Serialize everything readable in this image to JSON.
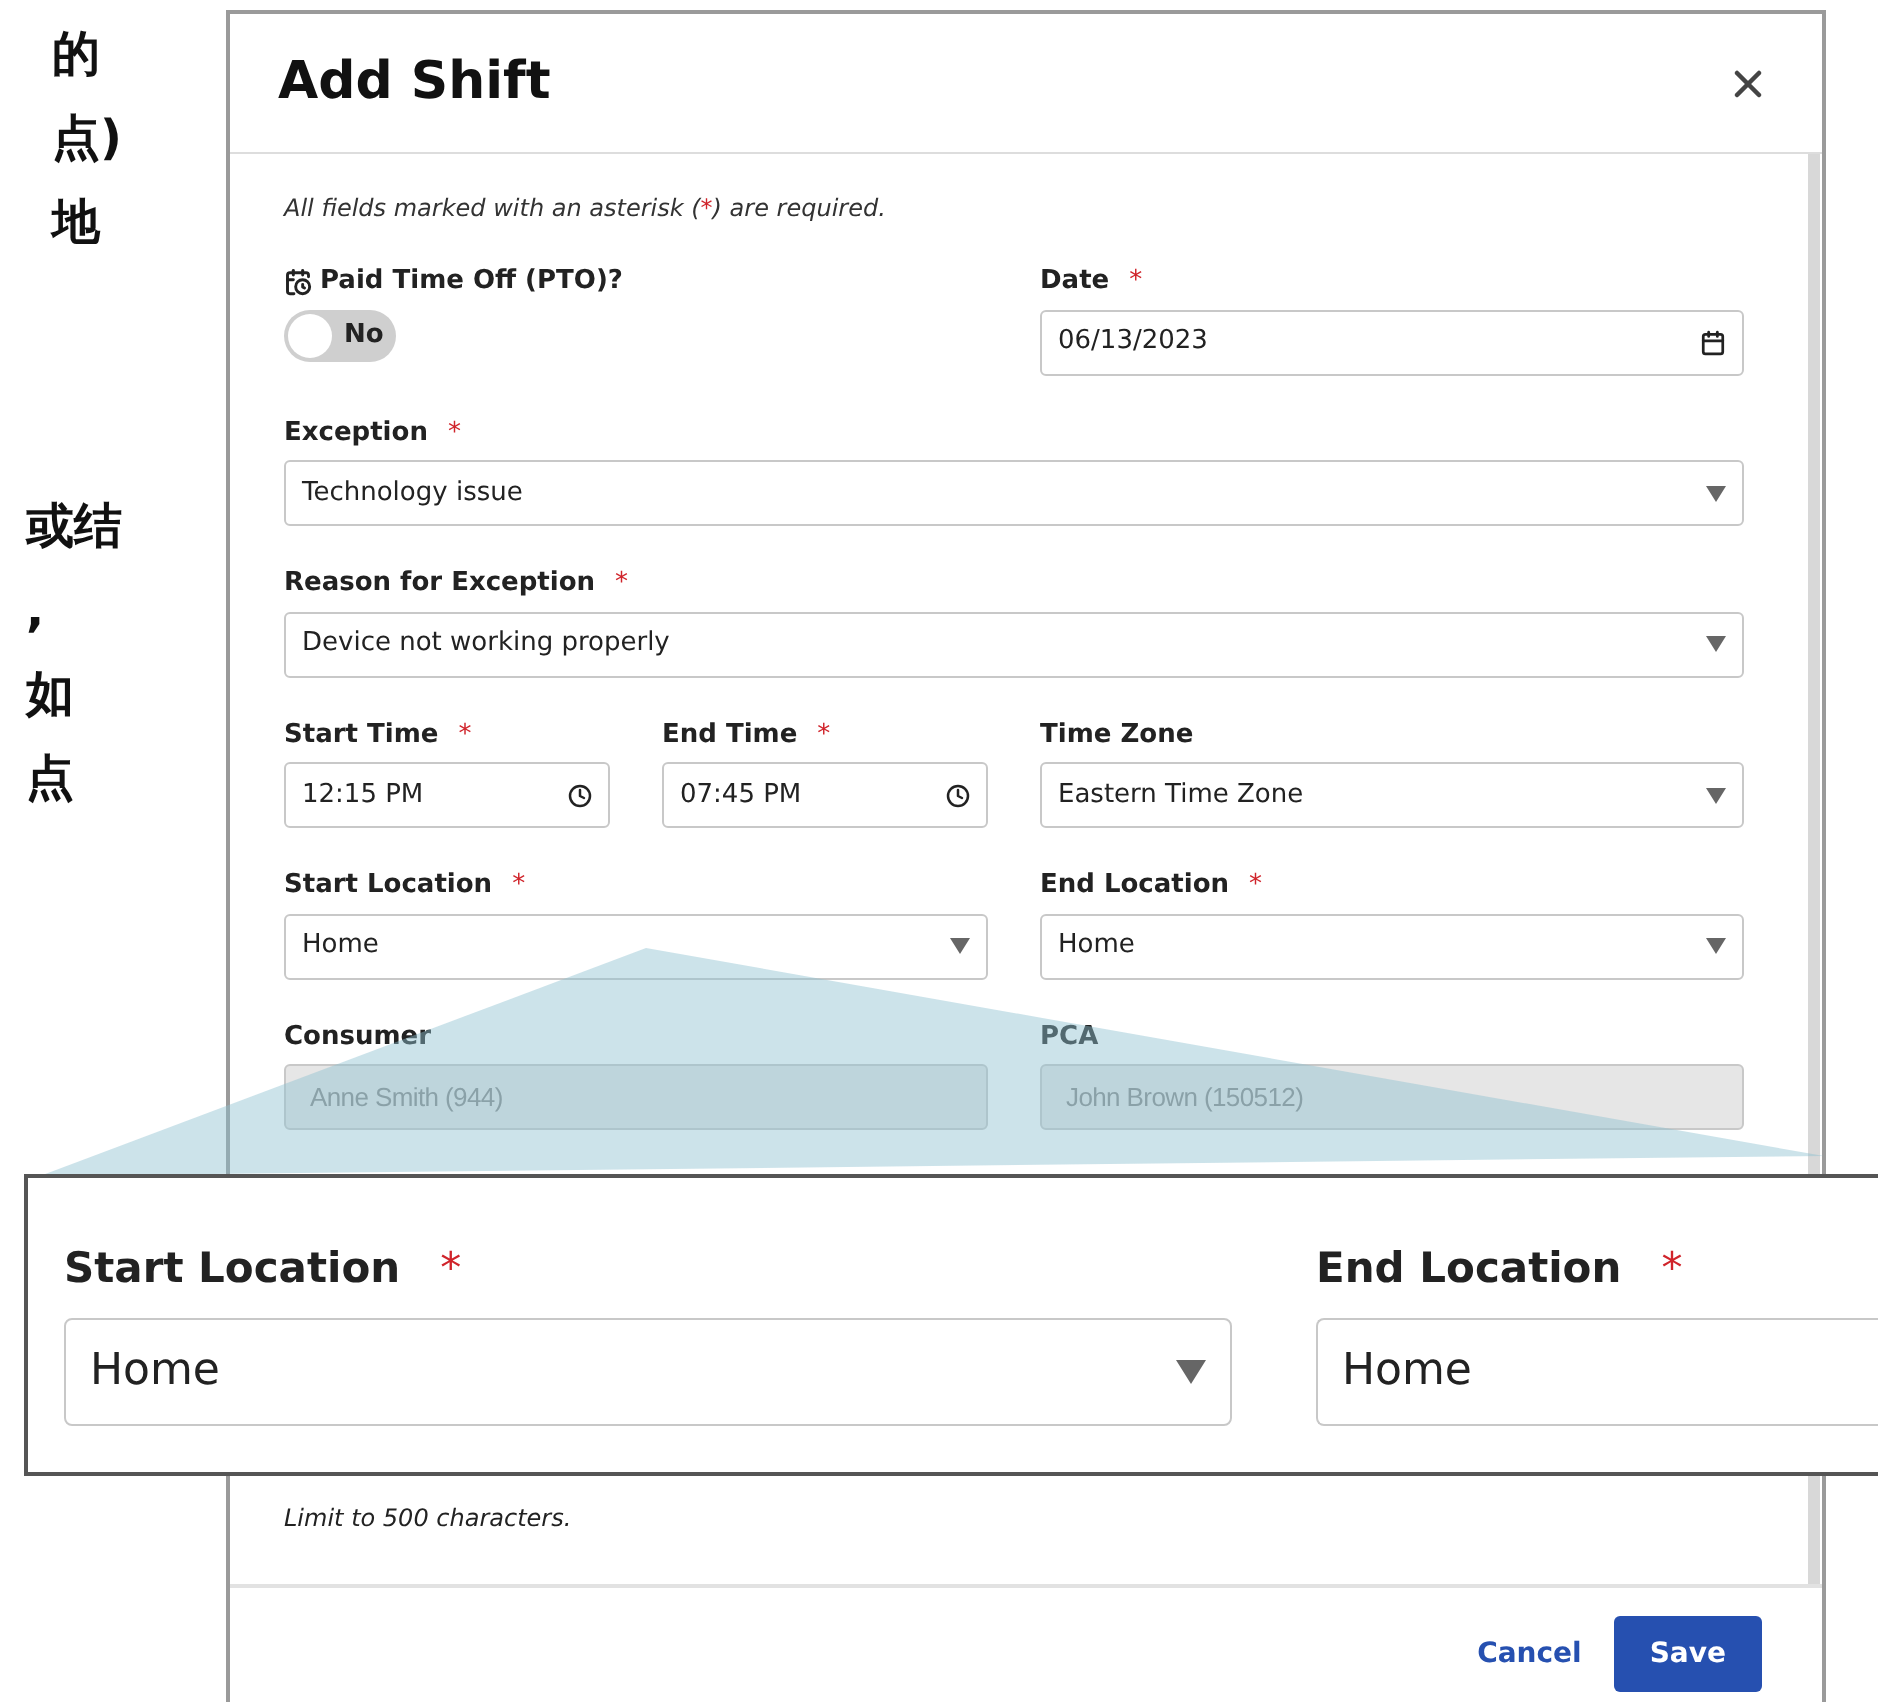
{
  "side_text": {
    "groups": [
      [
        "的",
        "点)",
        "地"
      ],
      [
        "或结",
        ",",
        "如",
        "点"
      ]
    ]
  },
  "dialog": {
    "title": "Add Shift",
    "required_note": {
      "before": "All fields marked with an asterisk (",
      "mark": "*",
      "after": ") are required."
    },
    "rows": [
      [
        {
          "kind": "toggle",
          "label": "Paid Time Off (PTO)?",
          "on": false,
          "value": "No"
        },
        {
          "kind": "date",
          "label": "Date",
          "mark": "*",
          "value": "06/13/2023"
        }
      ],
      [
        {
          "kind": "select",
          "label": "Exception",
          "mark": "*",
          "value": "Technology issue"
        }
      ],
      [
        {
          "kind": "select",
          "label": "Reason for Exception",
          "mark": "*",
          "value": "Device not working properly"
        }
      ],
      [
        {
          "kind": "time",
          "label": "Start Time",
          "mark": "*",
          "value": "12:15 PM"
        },
        {
          "kind": "time",
          "label": "End Time",
          "mark": "*",
          "value": "07:45 PM"
        },
        {
          "kind": "select",
          "label": "Time Zone",
          "value": "Eastern Time Zone"
        }
      ],
      [
        {
          "kind": "select",
          "label": "Start Location",
          "mark": "*",
          "value": "Home"
        },
        {
          "kind": "select",
          "label": "End Location",
          "mark": "*",
          "value": "Home"
        }
      ],
      [
        {
          "kind": "readonly",
          "label": "Consumer",
          "disabled": true,
          "value": "Anne Smith (944)"
        },
        {
          "kind": "readonly",
          "label": "PCA",
          "disabled": true,
          "value": "John Brown (150512)"
        }
      ]
    ],
    "hint": "Limit to 500 characters.",
    "buttons": [
      {
        "kind": "link",
        "label": "Cancel"
      },
      {
        "kind": "primary",
        "label": "Save"
      }
    ]
  },
  "callout": {
    "fields": [
      {
        "kind": "select",
        "label": "Start Location",
        "mark": "*",
        "value": "Home"
      },
      {
        "kind": "cut",
        "label": "End Location",
        "mark": "*",
        "value": "Home"
      }
    ]
  }
}
